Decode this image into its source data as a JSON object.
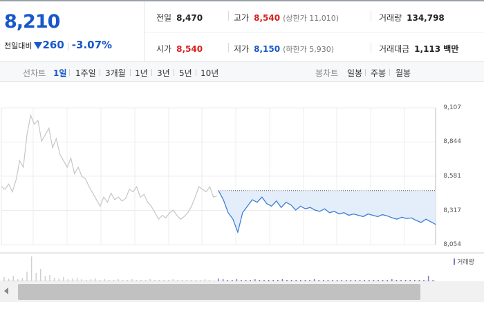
{
  "quote": {
    "price": "8,210",
    "diff_label": "전일대비",
    "diff_value": "260",
    "diff_rate": "-3.07%",
    "stats": {
      "prev_close": {
        "label": "전일",
        "value": "8,470"
      },
      "high": {
        "label": "고가",
        "value": "8,540",
        "sub": "(상한가 11,010)"
      },
      "volume": {
        "label": "거래량",
        "value": "134,798"
      },
      "open": {
        "label": "시가",
        "value": "8,540"
      },
      "low": {
        "label": "저가",
        "value": "8,150",
        "sub": "(하한가 5,930)"
      },
      "amount": {
        "label": "거래대금",
        "value": "1,113 백만"
      }
    }
  },
  "chart_types": {
    "line_title": "선차트",
    "line_options": [
      "1일",
      "1주일",
      "3개월",
      "1년",
      "3년",
      "5년",
      "10년"
    ],
    "line_active": "1일",
    "candle_title": "봉차트",
    "candle_options": [
      "일봉",
      "주봉",
      "월봉"
    ]
  },
  "colors": {
    "accent": "#1757c9",
    "up": "#d8201b",
    "prev_day_line": "#c6c6c6",
    "today_line": "#3a7fd5",
    "today_fill": "#e4edfa",
    "volume_bar": "#8a6fc9"
  },
  "chart_data": {
    "type": "line",
    "yticks": [
      "9,107",
      "8,844",
      "8,581",
      "8,317",
      "8,054"
    ],
    "ylim": [
      8054,
      9107
    ],
    "reference_price": 8470,
    "grid": true,
    "series": [
      {
        "values": [
          8500,
          8480,
          8520,
          8460,
          8550,
          8700,
          8650,
          8900,
          9050,
          8980,
          9010,
          8850,
          8900,
          8950,
          8800,
          8870,
          8750,
          8700,
          8650,
          8720,
          8600,
          8650,
          8580,
          8560,
          8500,
          8450,
          8400,
          8350,
          8420,
          8380,
          8450,
          8400,
          8420,
          8390,
          8410,
          8480,
          8460,
          8500,
          8420,
          8440,
          8380,
          8350,
          8300,
          8250,
          8280,
          8260,
          8300,
          8320,
          8280,
          8250,
          8270,
          8300,
          8350,
          8420,
          8500,
          8480,
          8460,
          8500,
          8420,
          8430
        ]
      },
      {
        "values": [
          8470,
          8400,
          8300,
          8250,
          8150,
          8300,
          8350,
          8400,
          8380,
          8420,
          8370,
          8350,
          8390,
          8340,
          8380,
          8360,
          8320,
          8350,
          8330,
          8340,
          8320,
          8310,
          8330,
          8300,
          8310,
          8290,
          8300,
          8280,
          8290,
          8280,
          8270,
          8290,
          8280,
          8270,
          8285,
          8275,
          8260,
          8250,
          8265,
          8255,
          8260,
          8240,
          8225,
          8250,
          8230,
          8210
        ]
      }
    ],
    "volume_label": "거래량"
  },
  "scrollbar": {
    "left_arrow": "scroll-left"
  }
}
